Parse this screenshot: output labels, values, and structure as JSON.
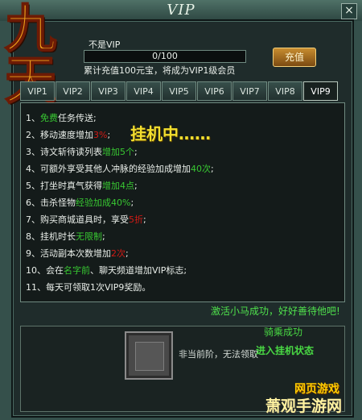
{
  "window": {
    "title": "VIP",
    "close_glyph": "×"
  },
  "logo": {
    "text": "九天",
    "icon": "game-logo-icon"
  },
  "status": {
    "label": "不是VIP",
    "progress_text": "0/100",
    "progress": 0,
    "hint": "累计充值100元宝，将成为VIP1级会员"
  },
  "recharge_button": "充值",
  "tabs": [
    "VIP1",
    "VIP2",
    "VIP3",
    "VIP4",
    "VIP5",
    "VIP6",
    "VIP7",
    "VIP8",
    "VIP9"
  ],
  "selected_tab": "VIP9",
  "benefits": [
    [
      "1、",
      "免费",
      "任务传送;"
    ],
    [
      "2、移动速度增加",
      "3%",
      ";"
    ],
    [
      "3、诗文斩待读列表",
      "增加5个",
      ";"
    ],
    [
      "4、可额外享受其他人冲脉的经验加成增加",
      "40次",
      ";"
    ],
    [
      "5、打坐时真气获得",
      "增加4点",
      ";"
    ],
    [
      "6、击杀怪物",
      "经验加成40%",
      ";"
    ],
    [
      "7、购买商城道具时，享受",
      "5折",
      ";"
    ],
    [
      "8、挂机时长",
      "无限制",
      ";"
    ],
    [
      "9、活动副本次数增加",
      "2次",
      ";"
    ],
    [
      "10、会在",
      "名字前",
      "、聊天频道增加VIP标志;"
    ],
    [
      "11、每天可领取1次VIP9奖励。"
    ]
  ],
  "hang_text": "挂机中……",
  "ride_note": "激活小马成功，好好善待他吧!",
  "mount": {
    "status": "非当前阶，无法领取",
    "ride_success": "骑乘成功",
    "enter_hang": "进入挂机状态"
  },
  "watermark": {
    "top": "网页游戏",
    "bottom": "萧观手游网"
  }
}
